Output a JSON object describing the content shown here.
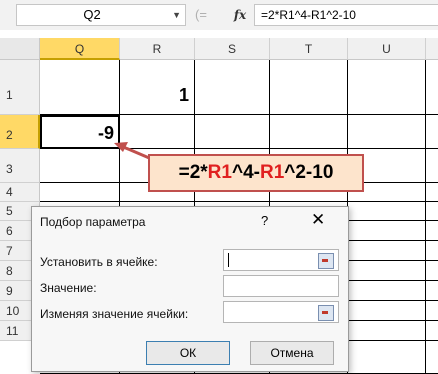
{
  "formula_bar": {
    "name_box": "Q2",
    "fx_label": "fx",
    "formula": "=2*R1^4-R1^2-10"
  },
  "grid": {
    "corner": "",
    "columns": [
      "Q",
      "R",
      "S",
      "T",
      "U"
    ],
    "selected_column": "Q",
    "rows": [
      "1",
      "2",
      "3",
      "4",
      "5",
      "6",
      "7",
      "8",
      "9",
      "10",
      "11"
    ],
    "selected_row": "2",
    "cell_R1": "1",
    "cell_Q2": "-9"
  },
  "callout": {
    "p1": "=2*",
    "p2": "R1",
    "p3": "^4-",
    "p4": "R1",
    "p5": "^2-10"
  },
  "dialog": {
    "title": "Подбор параметра",
    "help": "?",
    "close": "✕",
    "set_cell_label": "Установить в ячейке:",
    "value_label": "Значение:",
    "changing_cell_label": "Изменяя значение ячейки:",
    "set_cell_value": "",
    "value_value": "",
    "changing_cell_value": "",
    "ok": "ОК",
    "cancel": "Отмена"
  },
  "colors": {
    "header_selected": "#ffd966",
    "callout_fill": "#fde4cc",
    "callout_border": "#c0504d",
    "reference_red": "#e02020"
  }
}
